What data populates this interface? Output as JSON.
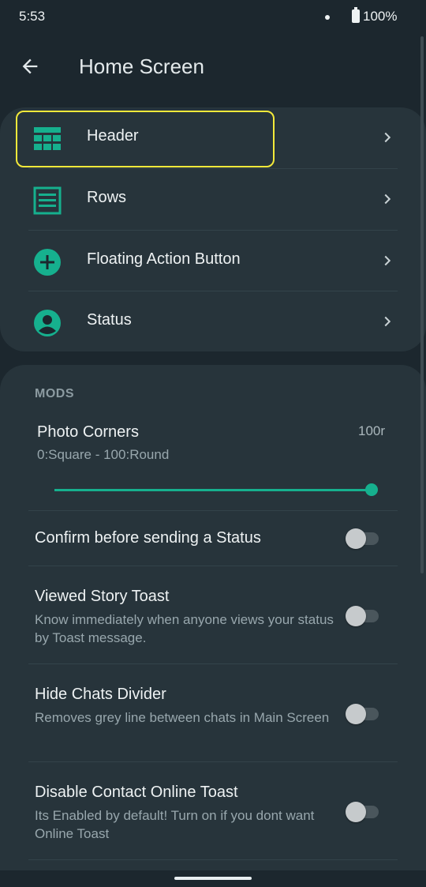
{
  "status_bar": {
    "time": "5:53",
    "battery": "100%"
  },
  "app_bar": {
    "title": "Home Screen",
    "back_icon": "arrow-back-icon"
  },
  "menu": {
    "items": [
      {
        "label": "Header",
        "icon": "grid-icon"
      },
      {
        "label": "Rows",
        "icon": "rows-icon"
      },
      {
        "label": "Floating Action Button",
        "icon": "add-circle-icon"
      },
      {
        "label": "Status",
        "icon": "account-circle-icon"
      }
    ]
  },
  "mods": {
    "header": "MODS",
    "photo_corners": {
      "title": "Photo Corners",
      "value": "100r",
      "subtitle": "0:Square - 100:Round",
      "slider_fraction": 1.0
    },
    "prefs": [
      {
        "title": "Confirm before sending a Status",
        "subtitle": "",
        "enabled": false
      },
      {
        "title": "Viewed Story Toast",
        "subtitle": "Know immediately when anyone views your status by Toast message.",
        "enabled": false
      },
      {
        "title": "Hide Chats Divider",
        "subtitle": "Removes grey line between chats in Main Screen",
        "enabled": false
      },
      {
        "title": "Disable Contact Online Toast",
        "subtitle": "Its Enabled by default! Turn on if you dont want Online Toast",
        "enabled": false
      }
    ]
  },
  "colors": {
    "accent": "#16b08e",
    "highlight": "#f3e93a",
    "background": "#1c272e",
    "card": "#27343b"
  }
}
